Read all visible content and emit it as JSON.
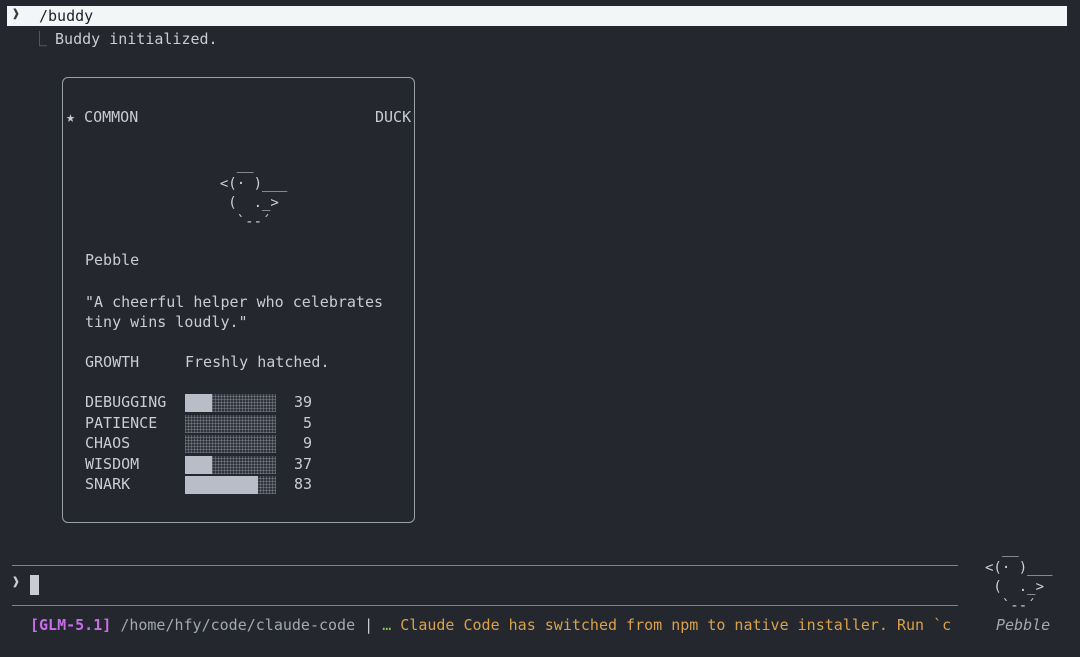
{
  "command": {
    "chevron": "❱",
    "text": "/buddy"
  },
  "result": {
    "elbow": "⎿",
    "text": "Buddy initialized."
  },
  "card": {
    "rarity": "★ COMMON",
    "species": "DUCK",
    "art": "    __\n  <(· )___\n   (  ._>\n    `--´",
    "name": "Pebble",
    "quote": "\"A cheerful helper who celebrates\ntiny wins loudly.\"",
    "growth_label": "GROWTH",
    "growth_value": "Freshly hatched.",
    "stats": [
      {
        "name": "DEBUGGING",
        "value": "39",
        "fill": 0.3
      },
      {
        "name": "PATIENCE",
        "value": "5",
        "fill": 0.0
      },
      {
        "name": "CHAOS",
        "value": "9",
        "fill": 0.0
      },
      {
        "name": "WISDOM",
        "value": "37",
        "fill": 0.3
      },
      {
        "name": "SNARK",
        "value": "83",
        "fill": 0.8
      }
    ]
  },
  "prompt": {
    "chevron": "❱"
  },
  "status": {
    "model": "[GLM-5.1]",
    "path": "/home/hfy/code/claude-code",
    "separator": "|",
    "dots": "…",
    "message": "Claude Code has switched from npm to native installer. Run `c"
  },
  "companion": {
    "art": "  __\n<(· )___\n (  ._>\n  `--´",
    "name": "Pebble"
  }
}
